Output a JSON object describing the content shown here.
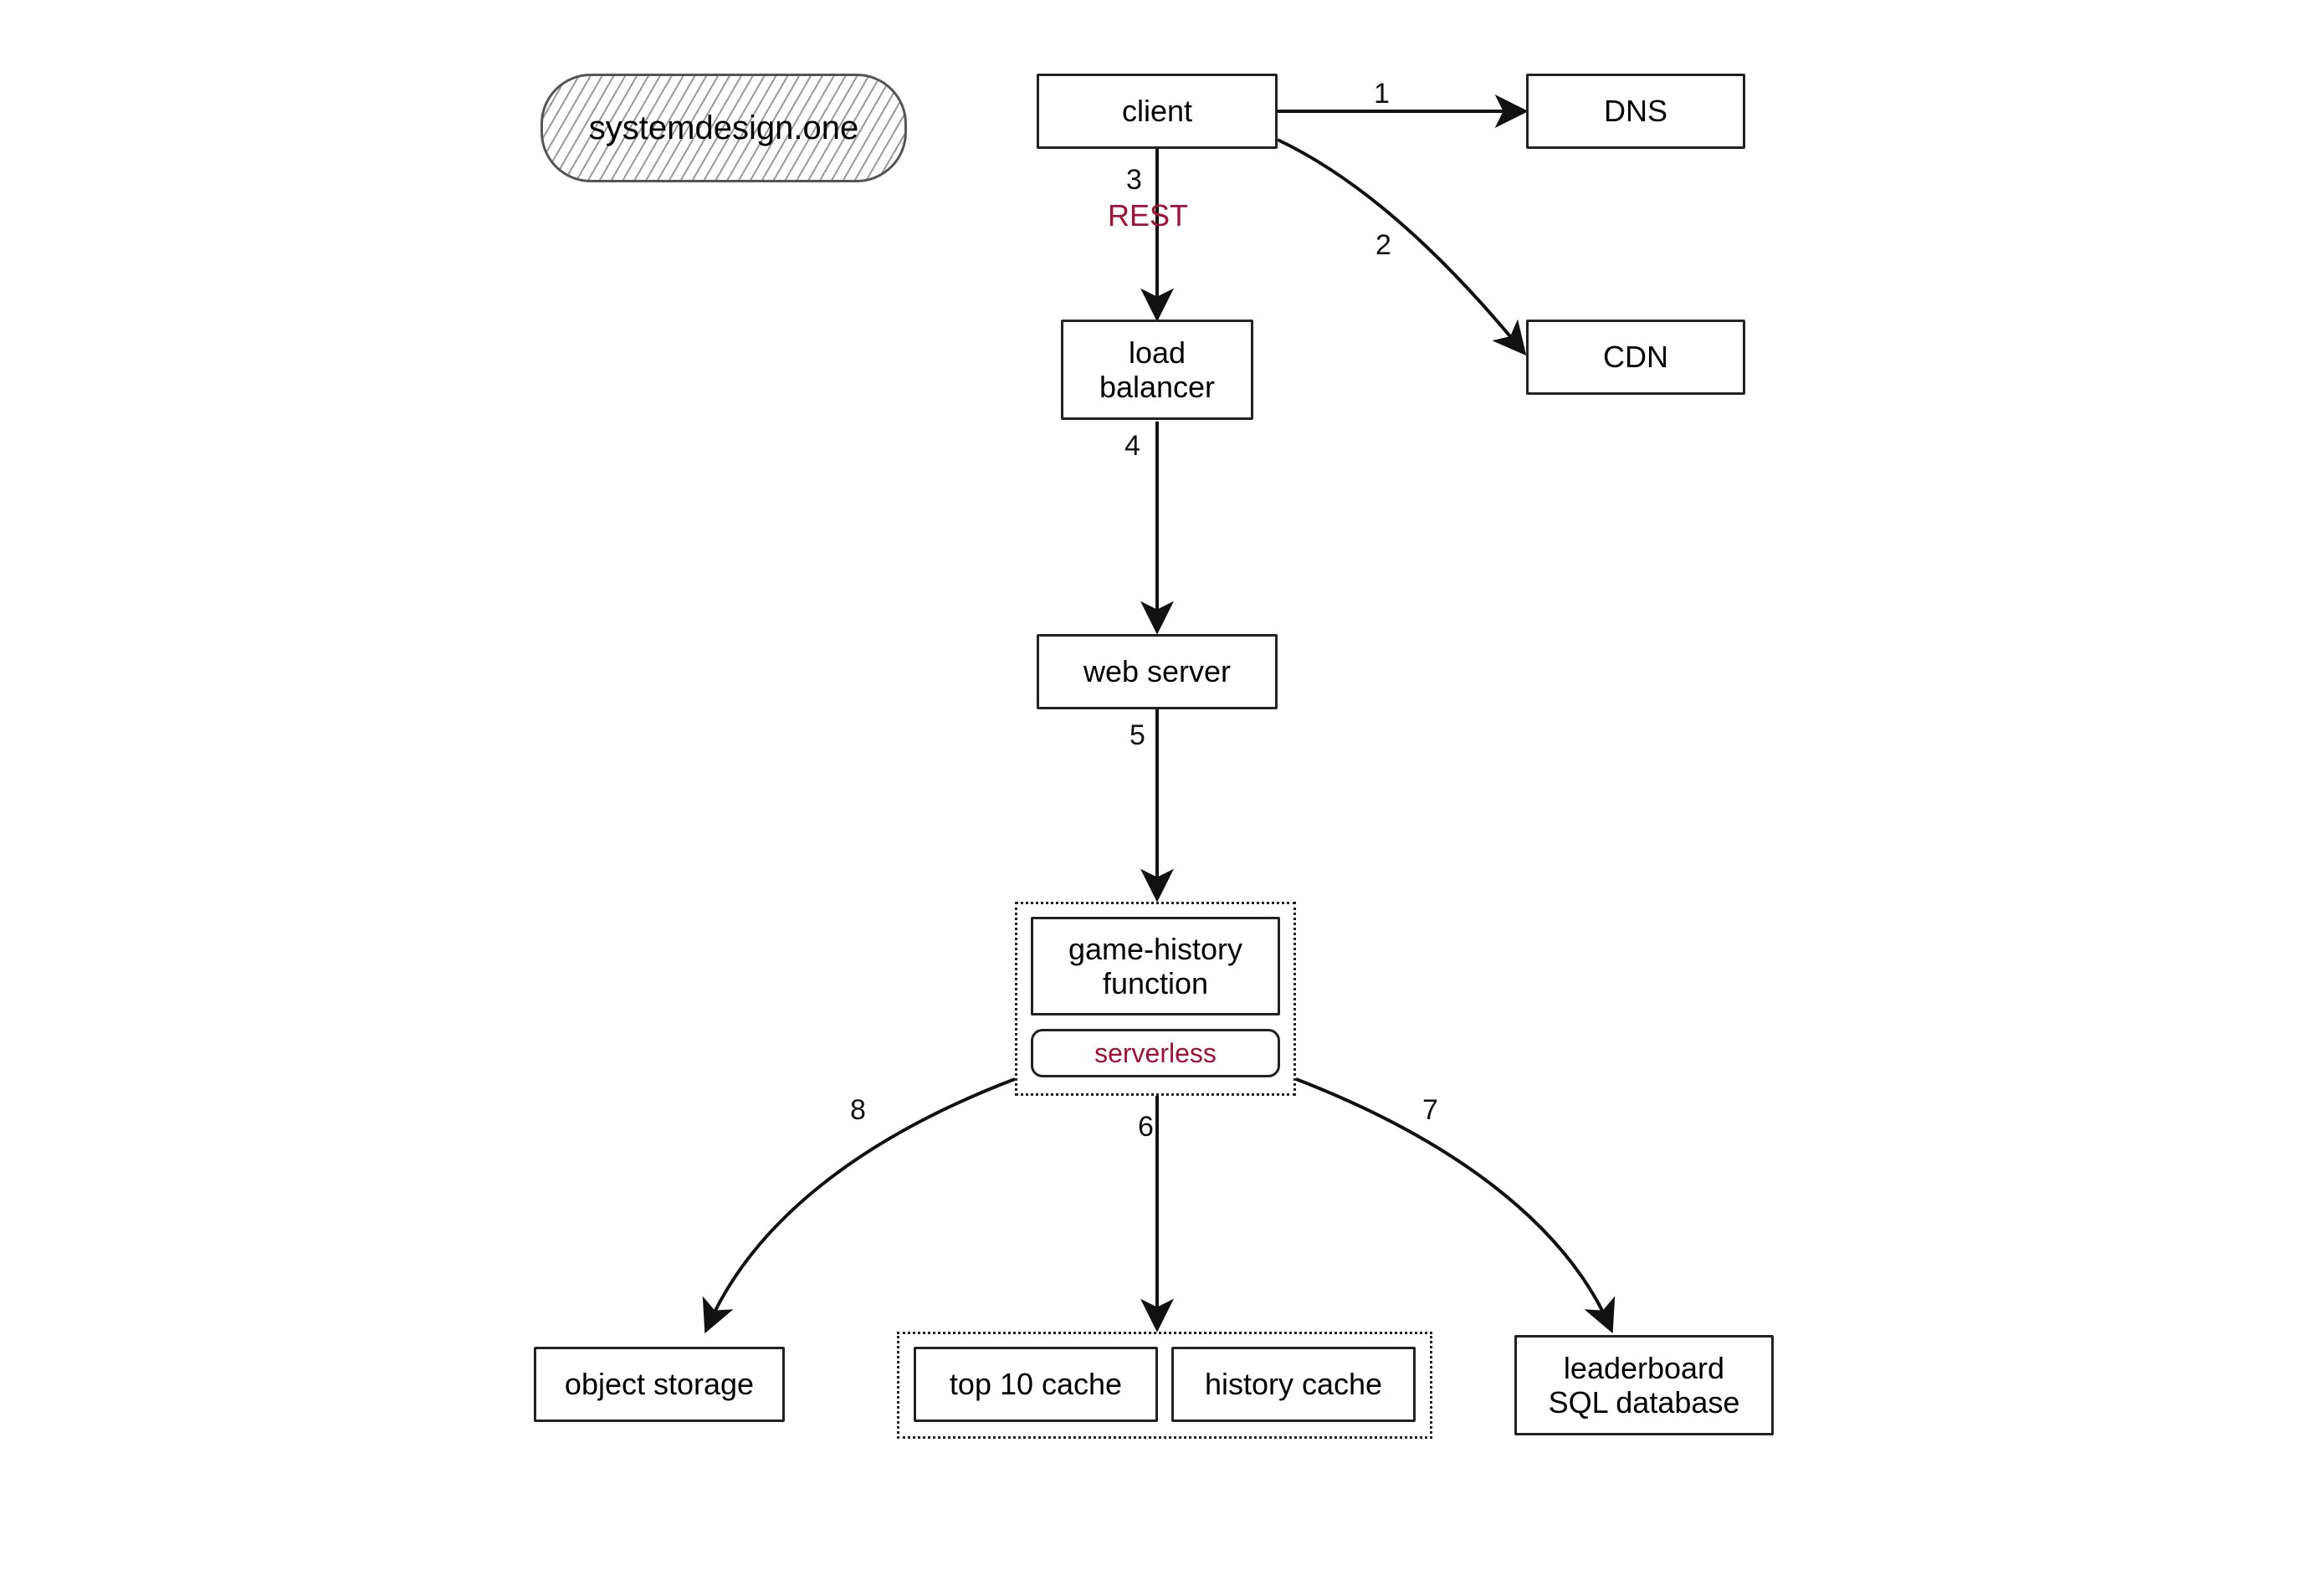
{
  "watermark": {
    "label": "systemdesign.one"
  },
  "nodes": {
    "client": {
      "label": "client"
    },
    "dns": {
      "label": "DNS"
    },
    "cdn": {
      "label": "CDN"
    },
    "load_balancer": {
      "label": "load\nbalancer"
    },
    "web_server": {
      "label": "web server"
    },
    "game_history": {
      "label": "game-history\nfunction",
      "tag": "serverless"
    },
    "object_storage": {
      "label": "object storage"
    },
    "top10_cache": {
      "label": "top 10 cache"
    },
    "history_cache": {
      "label": "history cache"
    },
    "leaderboard_db": {
      "label": "leaderboard\nSQL database"
    }
  },
  "edges": {
    "e1": {
      "num": "1"
    },
    "e2": {
      "num": "2"
    },
    "e3": {
      "num": "3",
      "proto": "REST"
    },
    "e4": {
      "num": "4"
    },
    "e5": {
      "num": "5"
    },
    "e6": {
      "num": "6"
    },
    "e7": {
      "num": "7"
    },
    "e8": {
      "num": "8"
    }
  }
}
